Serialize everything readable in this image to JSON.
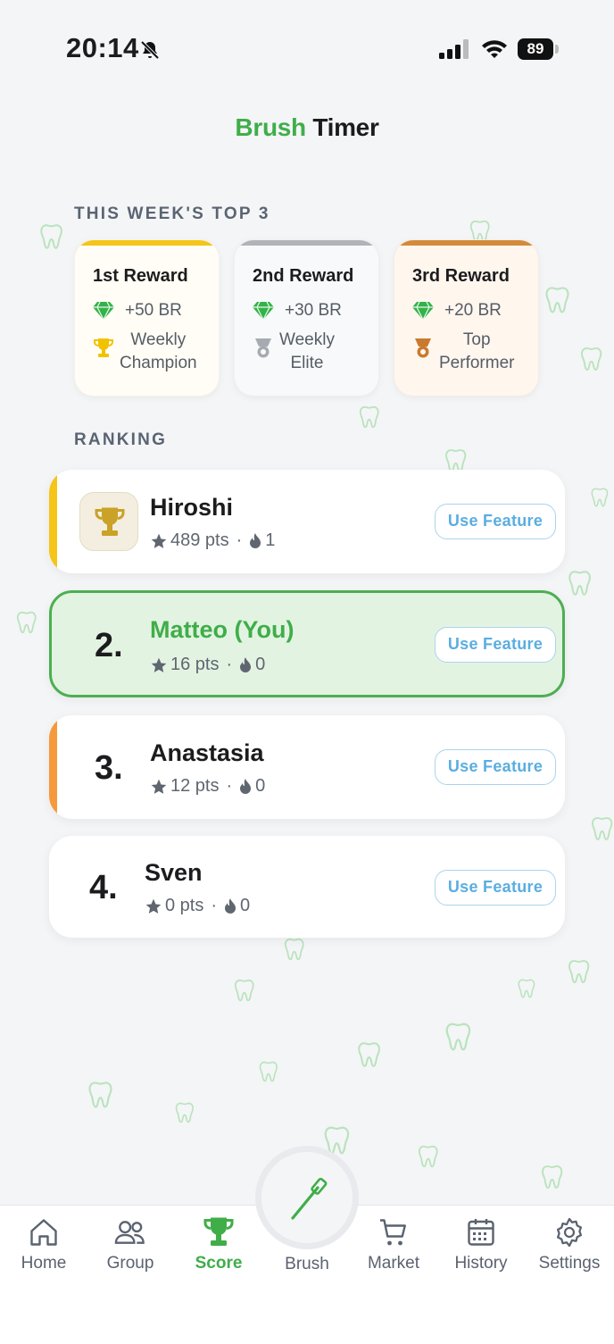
{
  "status": {
    "time": "20:14",
    "battery": "89"
  },
  "app": {
    "title_accent": "Brush",
    "title_rest": "Timer"
  },
  "sections": {
    "top3": "THIS WEEK'S TOP 3",
    "ranking": "RANKING"
  },
  "rewards": [
    {
      "title": "1st Reward",
      "amount": "+50 BR",
      "badge_line1": "Weekly",
      "badge_line2": "Champion",
      "badge_icon": "trophy-icon",
      "accent": "#f5c518"
    },
    {
      "title": "2nd Reward",
      "amount": "+30 BR",
      "badge_line1": "Weekly",
      "badge_line2": "Elite",
      "badge_icon": "silver-medal-icon",
      "accent": "#b0b3b8"
    },
    {
      "title": "3rd Reward",
      "amount": "+20 BR",
      "badge_line1": "Top",
      "badge_line2": "Performer",
      "badge_icon": "bronze-medal-icon",
      "accent": "#d38a3a"
    }
  ],
  "ranking": [
    {
      "rank": "",
      "name": "Hiroshi",
      "points": "489 pts",
      "streak": "1",
      "button": "Use Feature",
      "accent": "#f5c518",
      "highlight": false
    },
    {
      "rank": "2.",
      "name": "Matteo (You)",
      "points": "16 pts",
      "streak": "0",
      "button": "Use Feature",
      "accent": "#4caf50",
      "highlight": true
    },
    {
      "rank": "3.",
      "name": "Anastasia",
      "points": "12 pts",
      "streak": "0",
      "button": "Use Feature",
      "accent": "#f59a3c",
      "highlight": false
    },
    {
      "rank": "4.",
      "name": "Sven",
      "points": "0 pts",
      "streak": "0",
      "button": "Use Feature",
      "accent": "",
      "highlight": false
    }
  ],
  "nav": {
    "items": [
      {
        "label": "Home",
        "icon": "home-icon",
        "active": false
      },
      {
        "label": "Group",
        "icon": "group-icon",
        "active": false
      },
      {
        "label": "Score",
        "icon": "trophy-icon",
        "active": true
      },
      {
        "label": "Brush",
        "icon": "toothbrush-icon",
        "active": false
      },
      {
        "label": "Market",
        "icon": "cart-icon",
        "active": false
      },
      {
        "label": "History",
        "icon": "calendar-icon",
        "active": false
      },
      {
        "label": "Settings",
        "icon": "gear-icon",
        "active": false
      }
    ]
  },
  "colors": {
    "brand_green": "#3fae49",
    "button_blue": "#5aaee0",
    "background": "#f4f5f7"
  }
}
